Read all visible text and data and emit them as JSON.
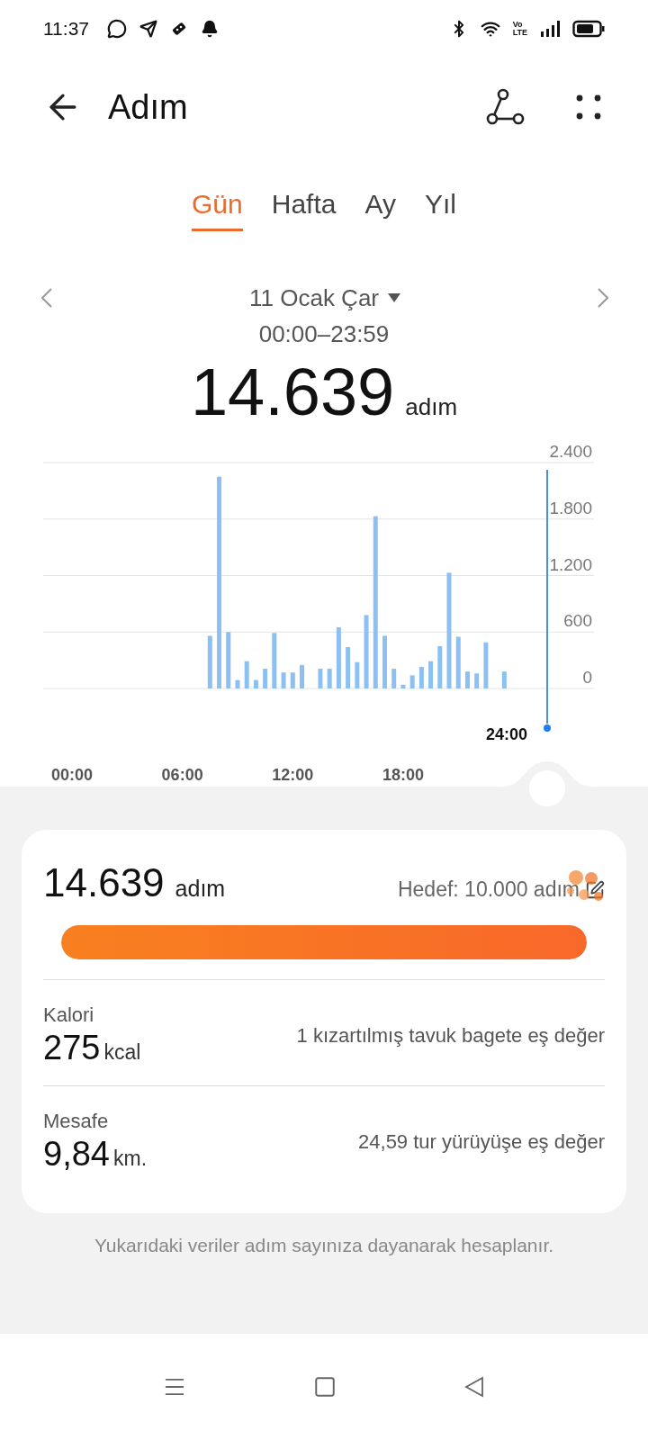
{
  "status_bar": {
    "time": "11:37",
    "network_label": [
      "Vo",
      "LTE"
    ]
  },
  "header": {
    "title": "Adım"
  },
  "tabs": [
    {
      "label": "Gün",
      "selected": true
    },
    {
      "label": "Hafta",
      "selected": false
    },
    {
      "label": "Ay",
      "selected": false
    },
    {
      "label": "Yıl",
      "selected": false
    }
  ],
  "date": {
    "label": "11 Ocak Çar",
    "range": "00:00–23:59"
  },
  "total": {
    "value": "14.639",
    "unit": "adım"
  },
  "chart": {
    "cursor_label": "24:00",
    "chart_data": {
      "type": "bar",
      "categories": [
        "00:00",
        null,
        null,
        null,
        null,
        null,
        null,
        null,
        null,
        null,
        null,
        null,
        "06:00",
        null,
        null,
        null,
        null,
        null,
        null,
        null,
        null,
        null,
        null,
        null,
        "12:00",
        null,
        null,
        null,
        null,
        null,
        null,
        null,
        null,
        null,
        null,
        null,
        "18:00",
        null,
        null,
        null,
        null,
        null,
        null,
        null,
        null,
        null,
        null,
        null
      ],
      "series": [
        {
          "color": "#8cc0f2",
          "values": [
            0,
            0,
            0,
            0,
            0,
            0,
            0,
            0,
            0,
            0,
            0,
            0,
            0,
            0,
            0,
            560,
            2250,
            600,
            90,
            290,
            90,
            210,
            590,
            170,
            170,
            250,
            0,
            210,
            210,
            650,
            440,
            280,
            780,
            1830,
            560,
            210,
            40,
            140,
            230,
            290,
            450,
            1230,
            550,
            180,
            160,
            490,
            0,
            180
          ]
        }
      ],
      "grid": true,
      "ylim": [
        0,
        2400
      ],
      "yticks": [
        {
          "value": 0,
          "label": "0"
        },
        {
          "value": 600,
          "label": "600"
        },
        {
          "value": 1200,
          "label": "1.200"
        },
        {
          "value": 1800,
          "label": "1.800"
        },
        {
          "value": 2400,
          "label": "2.400"
        }
      ]
    }
  },
  "summary": {
    "steps": "14.639",
    "unit": "adım",
    "goal": "Hedef: 10.000 adım",
    "level": 1,
    "rows": [
      {
        "label": "Kalori",
        "value": "275",
        "unit": "kcal",
        "note": "1 kızartılmış tavuk bagete eş değer"
      },
      {
        "label": "Mesafe",
        "value": "9,84",
        "unit": "km.",
        "note": "24,59 tur yürüyüşe eş değer"
      }
    ]
  },
  "footnote": "Yukarıdaki veriler adım sayınıza dayanarak hesaplanır."
}
